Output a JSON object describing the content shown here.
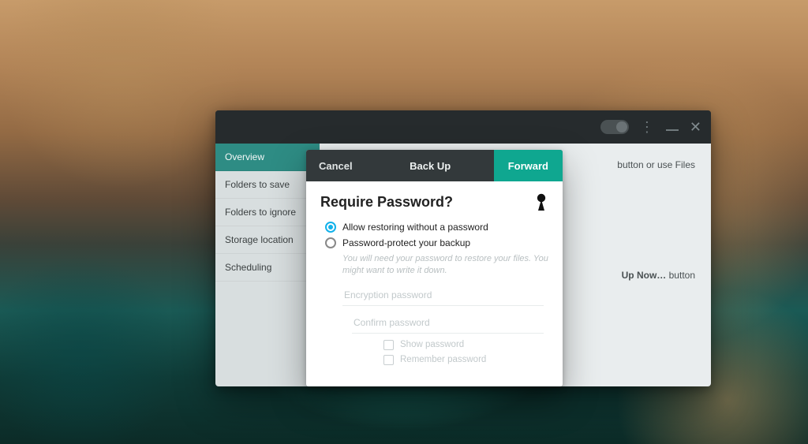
{
  "colors": {
    "accent": "#0fa790",
    "radio_accent": "#12b1ea"
  },
  "app": {
    "sidebar": {
      "items": [
        {
          "label": "Overview",
          "active": true
        },
        {
          "label": "Folders to save",
          "active": false
        },
        {
          "label": "Folders to ignore",
          "active": false
        },
        {
          "label": "Storage location",
          "active": false
        },
        {
          "label": "Scheduling",
          "active": false
        }
      ]
    },
    "main": {
      "hint_top_suffix": "button or use Files",
      "hint_mid_prefix": "",
      "hint_mid_bold": "Up Now…",
      "hint_mid_suffix": " button"
    }
  },
  "dialog": {
    "cancel_label": "Cancel",
    "title": "Back Up",
    "forward_label": "Forward",
    "heading": "Require Password?",
    "options": {
      "allow_no_pw": "Allow restoring without a password",
      "protect": "Password-protect your backup"
    },
    "protect_help": "You will need your password to restore your files. You might want to write it down.",
    "enc_placeholder": "Encryption password",
    "confirm_placeholder": "Confirm password",
    "show_pw": "Show password",
    "remember_pw": "Remember password",
    "selected_option": "allow_no_pw"
  }
}
